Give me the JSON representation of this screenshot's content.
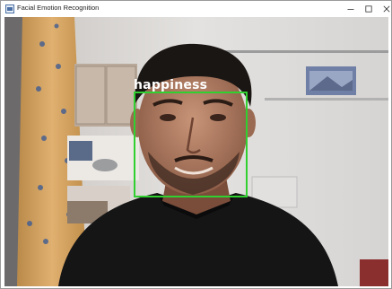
{
  "window": {
    "title": "Facial Emotion Recognition",
    "icon": "app-window-icon",
    "controls": {
      "minimize_icon": "minimize-icon",
      "maximize_icon": "maximize-icon",
      "close_icon": "close-icon"
    }
  },
  "video": {
    "detection": {
      "label": "happiness",
      "box_color": "#2fd02f",
      "label_color": "#ffffff"
    }
  }
}
